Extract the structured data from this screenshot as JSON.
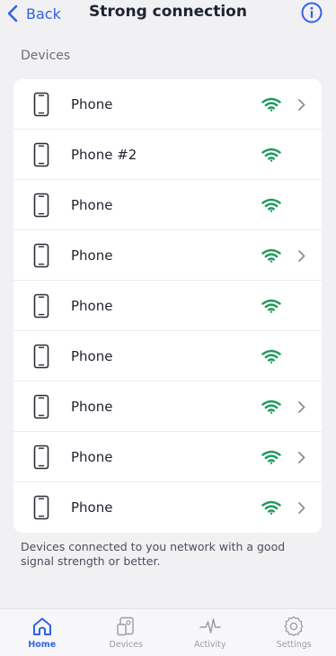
{
  "header": {
    "back_label": "Back",
    "title": "Strong connection"
  },
  "section_label": "Devices",
  "devices": [
    {
      "name": "Phone",
      "has_chevron": true
    },
    {
      "name": "Phone #2",
      "has_chevron": false
    },
    {
      "name": "Phone",
      "has_chevron": false
    },
    {
      "name": "Phone",
      "has_chevron": true
    },
    {
      "name": "Phone",
      "has_chevron": false
    },
    {
      "name": "Phone",
      "has_chevron": false
    },
    {
      "name": "Phone",
      "has_chevron": true
    },
    {
      "name": "Phone",
      "has_chevron": true
    },
    {
      "name": "Phone",
      "has_chevron": true
    }
  ],
  "note": "Devices connected to you network with a good signal strength or better.",
  "tabs": [
    {
      "label": "Home",
      "icon": "home-icon",
      "active": true
    },
    {
      "label": "Devices",
      "icon": "devices-icon",
      "active": false
    },
    {
      "label": "Activity",
      "icon": "activity-icon",
      "active": false
    },
    {
      "label": "Settings",
      "icon": "gear-icon",
      "active": false
    }
  ],
  "colors": {
    "accent": "#2f62e6",
    "signal_green": "#1f9a5c",
    "background": "#f1f1f4"
  }
}
